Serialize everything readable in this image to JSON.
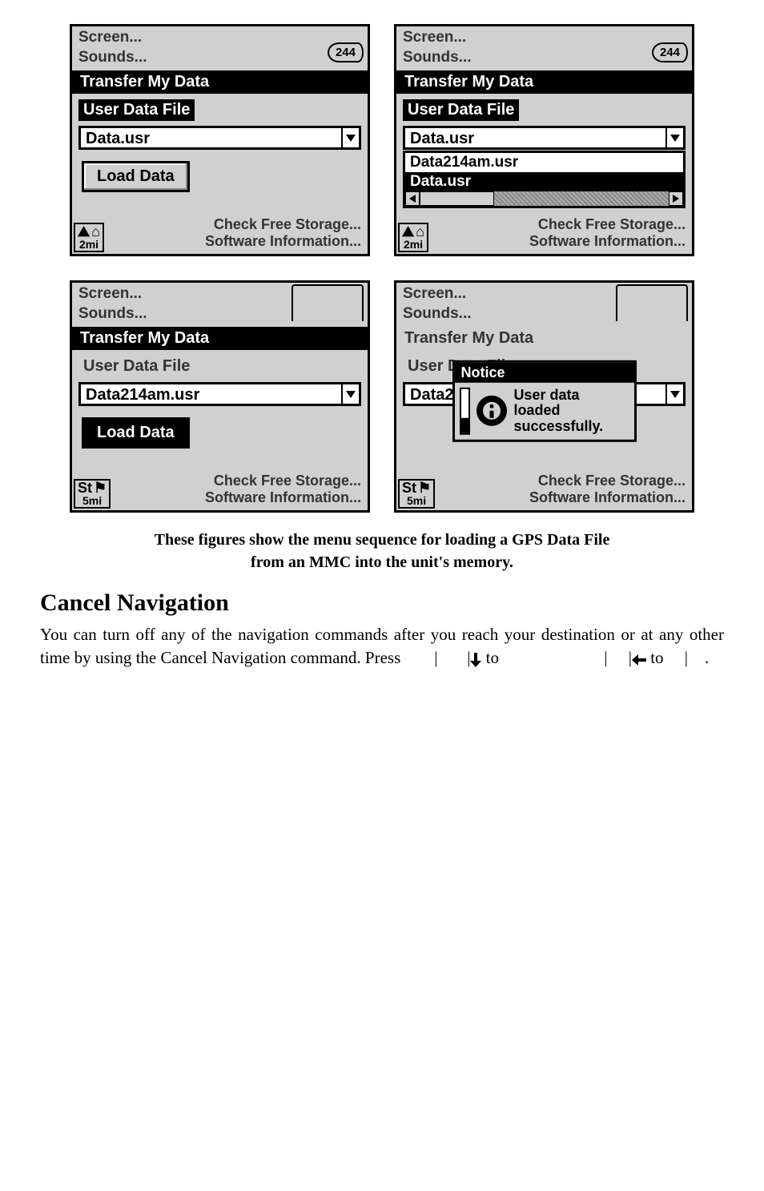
{
  "menu": {
    "screen": "Screen...",
    "sounds": "Sounds..."
  },
  "badge_text": "244",
  "section_title": "Transfer My Data",
  "sub_label": "User Data File",
  "options": {
    "data_usr": "Data.usr",
    "data214": "Data214am.usr"
  },
  "load_button": "Load Data",
  "notice": {
    "title": "Notice",
    "text1": "User data loaded",
    "text2": "successfully."
  },
  "bottom_menu": {
    "check": "Check Free Storage...",
    "software": "Software Information..."
  },
  "corner": {
    "mi2": "2mi",
    "mi5": "5mi",
    "st": "St"
  },
  "caption": {
    "line1": "These figures show the menu sequence for loading a GPS Data File",
    "line2": "from an MMC into the unit's memory."
  },
  "heading": "Cancel Navigation",
  "body": {
    "part1": "You can turn off any of the navigation commands after you reach your destination or at any other time by using the Cancel Navigation command. Press ",
    "to": " to ",
    "part5": "."
  }
}
